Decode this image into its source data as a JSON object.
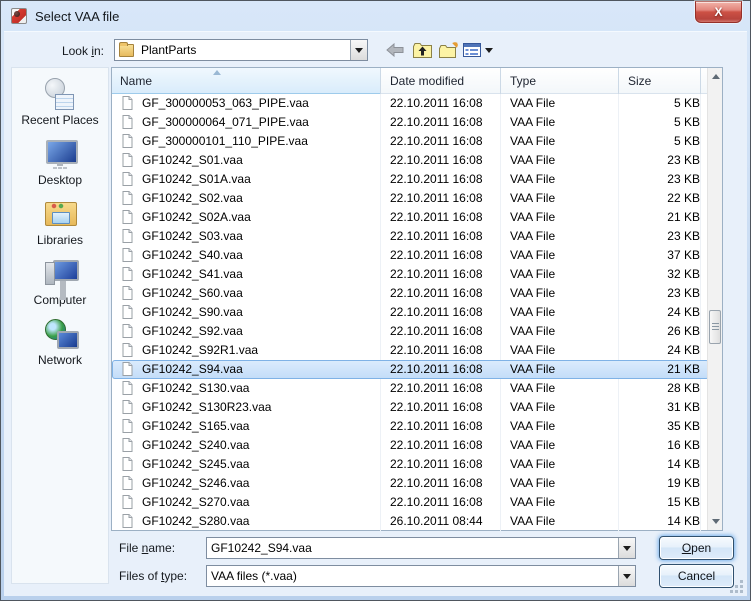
{
  "window": {
    "title": "Select VAA file",
    "close_glyph": "X"
  },
  "accent_colors": {
    "titlebar": "#c9ddf5",
    "selection_fill": "#cfe4fb",
    "selection_border": "#7fb2e6",
    "close_button": "#cc5145"
  },
  "toolbar": {
    "look_in": {
      "pre": "Look ",
      "key": "i",
      "post": "n:"
    },
    "location": "PlantParts",
    "icons": {
      "location": "folder-icon",
      "back": "back-arrow-icon",
      "up": "up-folder-icon",
      "new_folder": "new-folder-icon",
      "views": "views-list-icon",
      "views_caret": "chevron-down-icon"
    }
  },
  "sidebar": {
    "items": [
      {
        "icon": "recent-places",
        "label": "Recent Places"
      },
      {
        "icon": "desktop",
        "label": "Desktop"
      },
      {
        "icon": "libraries",
        "label": "Libraries"
      },
      {
        "icon": "computer",
        "label": "Computer"
      },
      {
        "icon": "network",
        "label": "Network"
      }
    ]
  },
  "list": {
    "columns": [
      "Name",
      "Date modified",
      "Type",
      "Size"
    ],
    "sort": {
      "column": "Name",
      "direction": "asc"
    },
    "selected_index": 14,
    "files": [
      {
        "name": "GF_300000053_063_PIPE.vaa",
        "date": "22.10.2011 16:08",
        "type": "VAA File",
        "size": "5 KB"
      },
      {
        "name": "GF_300000064_071_PIPE.vaa",
        "date": "22.10.2011 16:08",
        "type": "VAA File",
        "size": "5 KB"
      },
      {
        "name": "GF_300000101_110_PIPE.vaa",
        "date": "22.10.2011 16:08",
        "type": "VAA File",
        "size": "5 KB"
      },
      {
        "name": "GF10242_S01.vaa",
        "date": "22.10.2011 16:08",
        "type": "VAA File",
        "size": "23 KB"
      },
      {
        "name": "GF10242_S01A.vaa",
        "date": "22.10.2011 16:08",
        "type": "VAA File",
        "size": "23 KB"
      },
      {
        "name": "GF10242_S02.vaa",
        "date": "22.10.2011 16:08",
        "type": "VAA File",
        "size": "22 KB"
      },
      {
        "name": "GF10242_S02A.vaa",
        "date": "22.10.2011 16:08",
        "type": "VAA File",
        "size": "21 KB"
      },
      {
        "name": "GF10242_S03.vaa",
        "date": "22.10.2011 16:08",
        "type": "VAA File",
        "size": "23 KB"
      },
      {
        "name": "GF10242_S40.vaa",
        "date": "22.10.2011 16:08",
        "type": "VAA File",
        "size": "37 KB"
      },
      {
        "name": "GF10242_S41.vaa",
        "date": "22.10.2011 16:08",
        "type": "VAA File",
        "size": "32 KB"
      },
      {
        "name": "GF10242_S60.vaa",
        "date": "22.10.2011 16:08",
        "type": "VAA File",
        "size": "23 KB"
      },
      {
        "name": "GF10242_S90.vaa",
        "date": "22.10.2011 16:08",
        "type": "VAA File",
        "size": "24 KB"
      },
      {
        "name": "GF10242_S92.vaa",
        "date": "22.10.2011 16:08",
        "type": "VAA File",
        "size": "26 KB"
      },
      {
        "name": "GF10242_S92R1.vaa",
        "date": "22.10.2011 16:08",
        "type": "VAA File",
        "size": "24 KB"
      },
      {
        "name": "GF10242_S94.vaa",
        "date": "22.10.2011 16:08",
        "type": "VAA File",
        "size": "21 KB"
      },
      {
        "name": "GF10242_S130.vaa",
        "date": "22.10.2011 16:08",
        "type": "VAA File",
        "size": "28 KB"
      },
      {
        "name": "GF10242_S130R23.vaa",
        "date": "22.10.2011 16:08",
        "type": "VAA File",
        "size": "31 KB"
      },
      {
        "name": "GF10242_S165.vaa",
        "date": "22.10.2011 16:08",
        "type": "VAA File",
        "size": "35 KB"
      },
      {
        "name": "GF10242_S240.vaa",
        "date": "22.10.2011 16:08",
        "type": "VAA File",
        "size": "16 KB"
      },
      {
        "name": "GF10242_S245.vaa",
        "date": "22.10.2011 16:08",
        "type": "VAA File",
        "size": "14 KB"
      },
      {
        "name": "GF10242_S246.vaa",
        "date": "22.10.2011 16:08",
        "type": "VAA File",
        "size": "19 KB"
      },
      {
        "name": "GF10242_S270.vaa",
        "date": "22.10.2011 16:08",
        "type": "VAA File",
        "size": "15 KB"
      },
      {
        "name": "GF10242_S280.vaa",
        "date": "26.10.2011 08:44",
        "type": "VAA File",
        "size": "14 KB"
      }
    ]
  },
  "fields": {
    "file_name_label": {
      "pre": "File ",
      "key": "n",
      "post": "ame:"
    },
    "file_name_value": "GF10242_S94.vaa",
    "files_of_type_label": {
      "pre": "Files of ",
      "key": "t",
      "post": "ype:"
    },
    "files_of_type_value": "VAA files (*.vaa)"
  },
  "buttons": {
    "open": {
      "key": "O",
      "post": "pen"
    },
    "cancel": "Cancel"
  }
}
